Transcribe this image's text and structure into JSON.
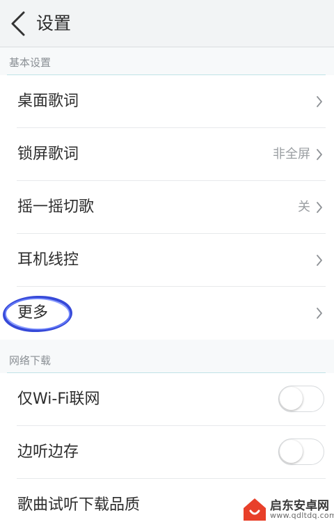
{
  "header": {
    "title": "设置",
    "back_icon": "chevron-left-icon"
  },
  "sections": [
    {
      "title": "基本设置",
      "items": [
        {
          "label": "桌面歌词",
          "value": "",
          "control": "chevron"
        },
        {
          "label": "锁屏歌词",
          "value": "非全屏",
          "control": "chevron"
        },
        {
          "label": "摇一摇切歌",
          "value": "关",
          "control": "chevron"
        },
        {
          "label": "耳机线控",
          "value": "",
          "control": "chevron"
        },
        {
          "label": "更多",
          "value": "",
          "control": "chevron"
        }
      ]
    },
    {
      "title": "网络下载",
      "items": [
        {
          "label": "仅Wi-Fi联网",
          "control": "toggle",
          "on": false
        },
        {
          "label": "边听边存",
          "control": "toggle",
          "on": false
        },
        {
          "label": "歌曲试听下载品质",
          "control": "chevron"
        }
      ]
    }
  ],
  "annotation": {
    "ring_color": "#2b3fd6"
  },
  "watermark": {
    "site_name": "启东安卓网",
    "url": "www.qdltdq.com",
    "logo_color": "#e8402a"
  },
  "colors": {
    "accent_rule": "#bfe3e6",
    "text_primary": "#2c2c2c",
    "text_secondary": "#9a9ea2"
  }
}
